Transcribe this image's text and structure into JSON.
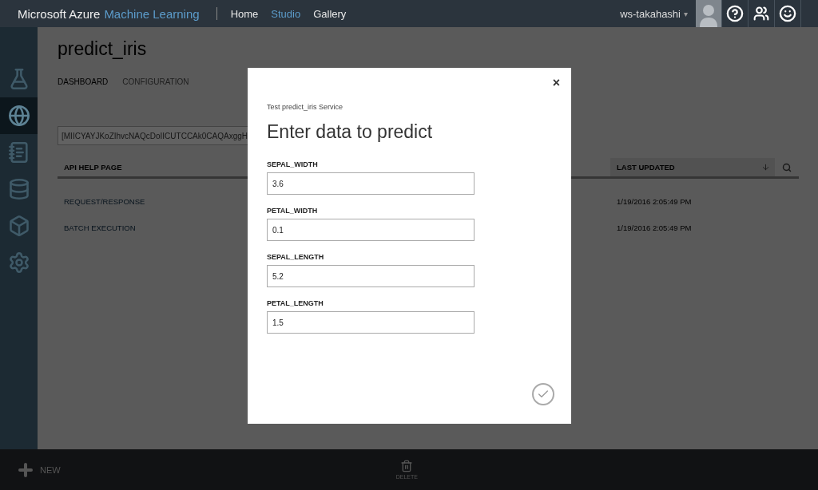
{
  "top_bar": {
    "brand": "Microsoft Azure",
    "product": "Machine Learning",
    "nav": [
      {
        "label": "Home",
        "selected": false
      },
      {
        "label": "Studio",
        "selected": true
      },
      {
        "label": "Gallery",
        "selected": false
      }
    ],
    "user": "ws-takahashi",
    "caret": "▾"
  },
  "sidebar": {
    "items": [
      {
        "kind": "flask",
        "selected": false
      },
      {
        "kind": "globe",
        "selected": true
      },
      {
        "kind": "notebook",
        "selected": false
      },
      {
        "kind": "datasets",
        "selected": false
      },
      {
        "kind": "cube",
        "selected": false
      },
      {
        "kind": "gear",
        "selected": false
      }
    ]
  },
  "page": {
    "title": "predict_iris",
    "tabs": [
      {
        "label": "DASHBOARD",
        "selected": true
      },
      {
        "label": "CONFIGURATION",
        "selected": false
      }
    ],
    "api_key": "[MIICYAYJKoZIhvcNAQcDoIICUTCCAk0CAQAxggH",
    "table": {
      "columns": [
        "API HELP PAGE",
        "LAST UPDATED"
      ],
      "rows": [
        {
          "link": "REQUEST/RESPONSE",
          "updated": "1/19/2016 2:05:49 PM"
        },
        {
          "link": "BATCH EXECUTION",
          "updated": "1/19/2016 2:05:49 PM"
        }
      ]
    }
  },
  "dialog": {
    "subtitle": "Test predict_iris Service",
    "title": "Enter data to predict",
    "close": "×",
    "fields": [
      {
        "label": "SEPAL_WIDTH",
        "value": "3.6"
      },
      {
        "label": "PETAL_WIDTH",
        "value": "0.1"
      },
      {
        "label": "SEPAL_LENGTH",
        "value": "5.2"
      },
      {
        "label": "PETAL_LENGTH",
        "value": "1.5"
      }
    ]
  },
  "command_bar": {
    "new": "NEW",
    "delete": "DELETE"
  }
}
